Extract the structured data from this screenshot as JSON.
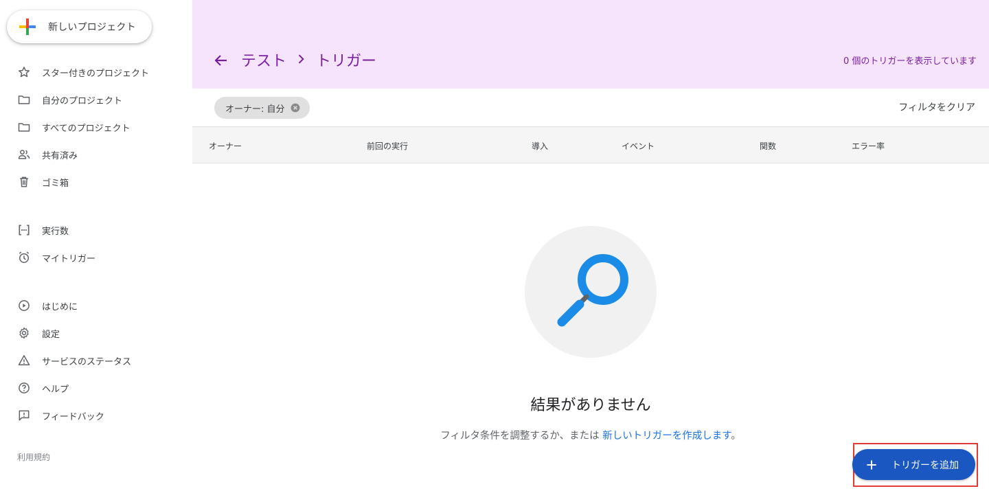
{
  "sidebar": {
    "new_project_label": "新しいプロジェクト",
    "items_top": [
      {
        "label": "スター付きのプロジェクト",
        "icon": "star-icon"
      },
      {
        "label": "自分のプロジェクト",
        "icon": "folder-icon"
      },
      {
        "label": "すべてのプロジェクト",
        "icon": "folder-icon"
      },
      {
        "label": "共有済み",
        "icon": "people-icon"
      },
      {
        "label": "ゴミ箱",
        "icon": "trash-icon"
      }
    ],
    "items_mid": [
      {
        "label": "実行数",
        "icon": "executions-icon"
      },
      {
        "label": "マイトリガー",
        "icon": "alarm-icon"
      }
    ],
    "items_bottom": [
      {
        "label": "はじめに",
        "icon": "play-circle-icon"
      },
      {
        "label": "設定",
        "icon": "gear-icon"
      },
      {
        "label": "サービスのステータス",
        "icon": "warning-icon"
      },
      {
        "label": "ヘルプ",
        "icon": "help-icon"
      },
      {
        "label": "フィードバック",
        "icon": "feedback-icon"
      }
    ],
    "terms": "利用規約"
  },
  "header": {
    "breadcrumb_project": "テスト",
    "breadcrumb_page": "トリガー",
    "count_text": "0 個のトリガーを表示しています"
  },
  "filter": {
    "chip": "オーナー: 自分",
    "clear": "フィルタをクリア"
  },
  "table": {
    "columns": [
      "オーナー",
      "前回の実行",
      "導入",
      "イベント",
      "関数",
      "エラー率"
    ]
  },
  "empty": {
    "title": "結果がありません",
    "subtitle_prefix": "フィルタ条件を調整するか、または ",
    "subtitle_link": "新しいトリガーを作成します",
    "subtitle_suffix": "。"
  },
  "fab": {
    "label": "トリガーを追加"
  },
  "colors": {
    "header_bg": "#f6e4fc",
    "header_text": "#7b1fa2",
    "link": "#1a73e8",
    "fab_bg": "#1a57c0",
    "highlight": "#e53935"
  }
}
